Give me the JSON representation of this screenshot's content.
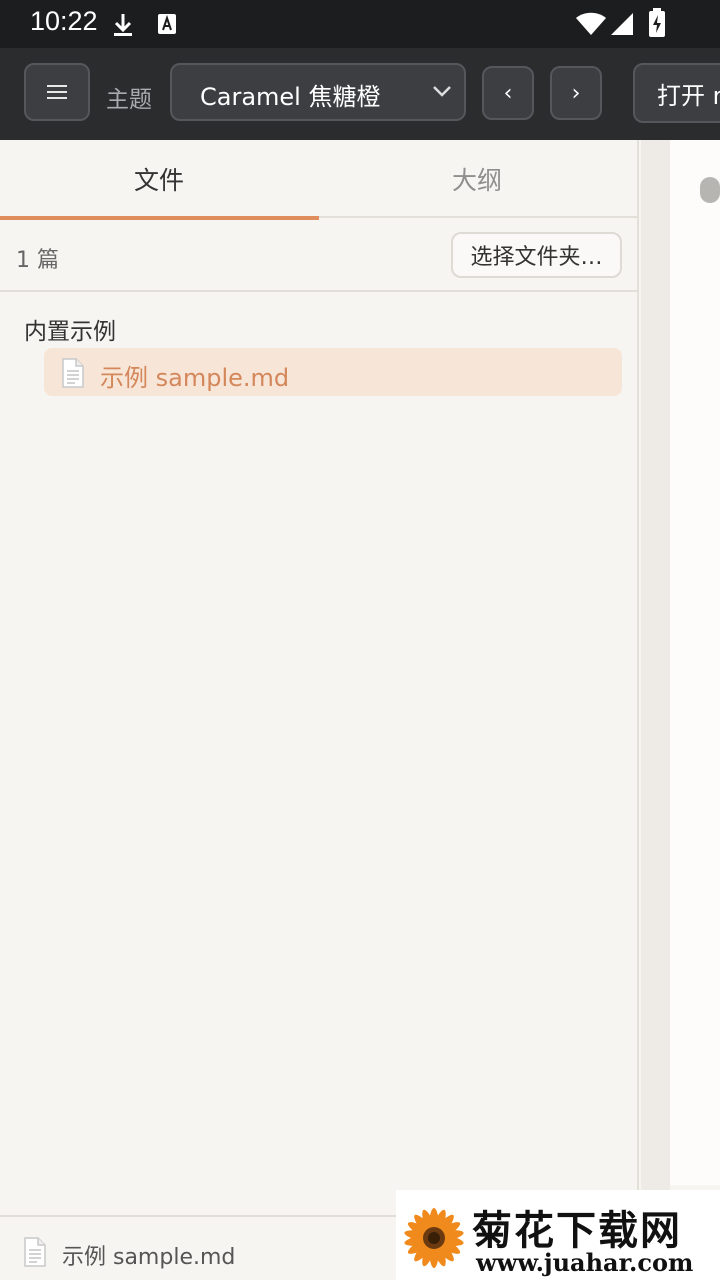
{
  "status_bar": {
    "time": "10:22",
    "icons": [
      "download-icon",
      "font-a-icon",
      "wifi-icon",
      "signal-icon",
      "battery-charging-icon"
    ]
  },
  "toolbar": {
    "menu_icon": "hamburger-menu-icon",
    "theme_label": "主题",
    "theme_value": "Caramel 焦糖橙",
    "prev_label": "‹",
    "next_label": "›",
    "open_label": "打开 m"
  },
  "sidebar": {
    "tabs": [
      {
        "label": "文件",
        "active": true
      },
      {
        "label": "大纲",
        "active": false
      }
    ],
    "count": "1 篇",
    "choose_folder": "选择文件夹…",
    "group_label": "内置示例",
    "files": [
      {
        "label": "示例 sample.md",
        "icon": "file-icon",
        "selected": true
      }
    ]
  },
  "footer": {
    "icon": "file-icon",
    "current_file": "示例 sample.md"
  },
  "watermark": {
    "title": "菊花下载网",
    "url": "www.juahar.com"
  },
  "colors": {
    "accent": "#e08d5e",
    "selected_bg": "#f7e5d8",
    "toolbar_bg": "#2b2c2e",
    "status_bar_bg": "#1c1d1f"
  }
}
